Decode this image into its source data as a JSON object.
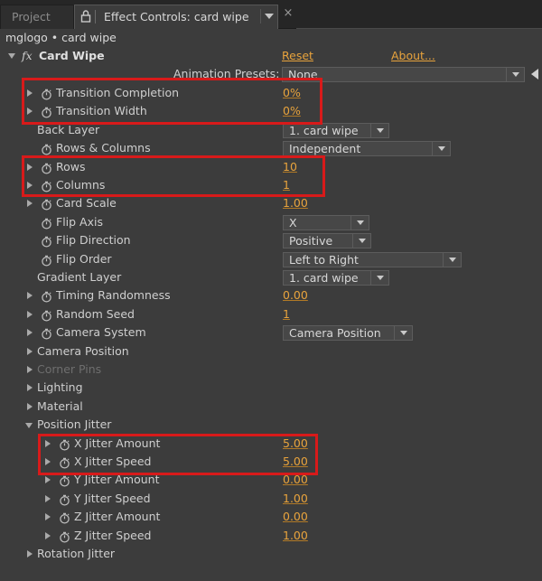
{
  "tabs": {
    "project": "Project",
    "effect_controls": "Effect Controls: card wipe",
    "close_glyph": "×"
  },
  "subheader": "mglogo • card wipe",
  "effect": {
    "fx_glyph": "fx",
    "name": "Card Wipe",
    "reset_label": "Reset",
    "about_label": "About...",
    "presets_label": "Animation Presets:",
    "presets_value": "None"
  },
  "properties": [
    {
      "label": "Transition Completion",
      "value": "0%"
    },
    {
      "label": "Transition Width",
      "value": "0%"
    },
    {
      "label": "Back Layer",
      "dropdown": "1. card wipe"
    },
    {
      "label": "Rows & Columns",
      "dropdown": "Independent"
    },
    {
      "label": "Rows",
      "value": "10"
    },
    {
      "label": "Columns",
      "value": "1"
    },
    {
      "label": "Card Scale",
      "value": "1.00"
    },
    {
      "label": "Flip Axis",
      "dropdown": "X"
    },
    {
      "label": "Flip Direction",
      "dropdown": "Positive"
    },
    {
      "label": "Flip Order",
      "dropdown": "Left to Right"
    },
    {
      "label": "Gradient Layer",
      "dropdown": "1. card wipe"
    },
    {
      "label": "Timing Randomness",
      "value": "0.00"
    },
    {
      "label": "Random Seed",
      "value": "1"
    },
    {
      "label": "Camera System",
      "dropdown": "Camera Position"
    },
    {
      "label": "Camera Position"
    },
    {
      "label": "Corner Pins"
    },
    {
      "label": "Lighting"
    },
    {
      "label": "Material"
    },
    {
      "label": "Position Jitter"
    },
    {
      "label": "X Jitter Amount",
      "value": "5.00"
    },
    {
      "label": "X Jitter Speed",
      "value": "5.00"
    },
    {
      "label": "Y Jitter Amount",
      "value": "0.00"
    },
    {
      "label": "Y Jitter Speed",
      "value": "1.00"
    },
    {
      "label": "Z Jitter Amount",
      "value": "0.00"
    },
    {
      "label": "Z Jitter Speed",
      "value": "1.00"
    },
    {
      "label": "Rotation Jitter"
    }
  ],
  "colors": {
    "panel": "#3c3c3c",
    "value_orange": "#e8a33c",
    "highlight_red": "#d81a1a",
    "disabled_text": "#6e6e6e"
  }
}
